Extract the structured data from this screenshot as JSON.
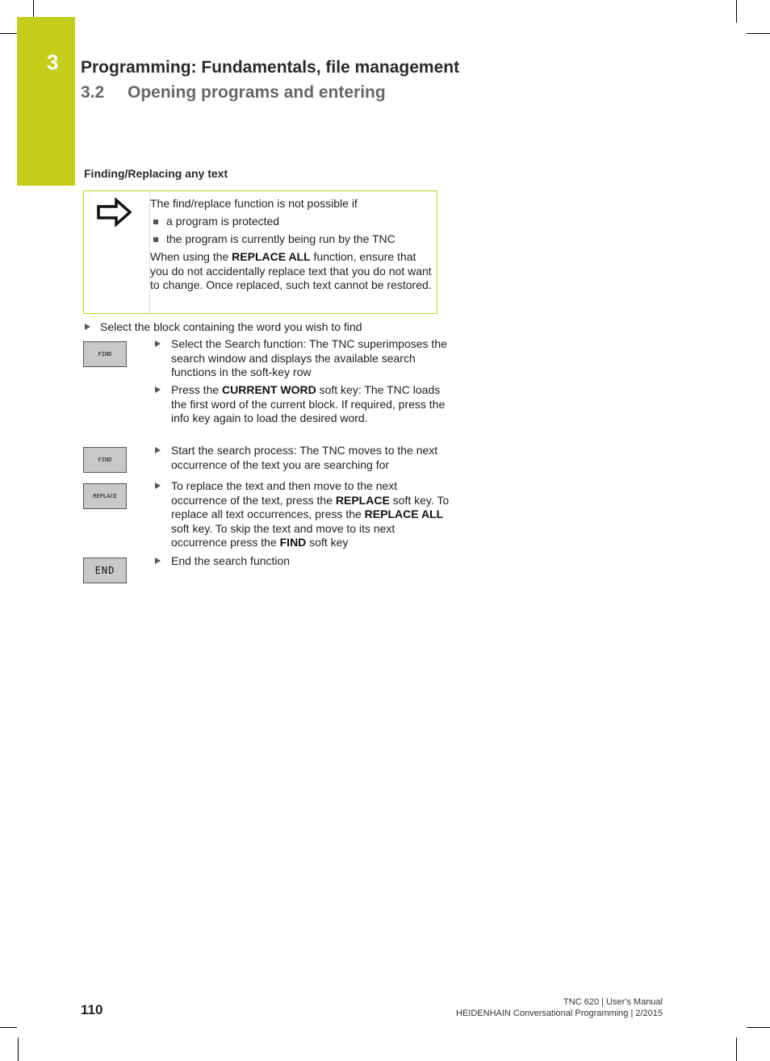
{
  "chapter": {
    "number": "3",
    "title": "Programming: Fundamentals, file management",
    "section_number": "3.2",
    "section_title": "Opening programs and entering",
    "accent_color": "#c4cd1a"
  },
  "subsection_title": "Finding/Replacing any text",
  "note": {
    "icon": "arrow-right-icon",
    "intro": "The find/replace function is not possible if",
    "bullets": [
      "a program is protected",
      "the program is currently being run by the TNC"
    ],
    "warning_pre": "When using the ",
    "warning_bold": "REPLACE ALL",
    "warning_post": " function, ensure that you do not accidentally replace text that you do not want to change. Once replaced, such text cannot be restored."
  },
  "intro_step": "Select the block containing the word you wish to find",
  "softkeys": {
    "find1": "FIND",
    "find2": "FIND",
    "replace": "REPLACE",
    "end": "END"
  },
  "steps": {
    "s1": "Select the Search function: The TNC superimposes the search window and displays the available search functions in the soft-key row",
    "s2_pre": "Press the ",
    "s2_bold": "CURRENT WORD",
    "s2_post": " soft key: The TNC loads the first word of the current block. If required, press the info key again to load the desired word.",
    "s3": "Start the search process: The TNC moves to the next occurrence of the text you are searching for",
    "s4_a": "To replace the text and then move to the next occurrence of the text, press the ",
    "s4_b": "REPLACE",
    "s4_c": " soft key. To replace all text occurrences, press the ",
    "s4_d": "REPLACE ALL",
    "s4_e": " soft key. To skip the text and move to its next occurrence press the ",
    "s4_f": "FIND",
    "s4_g": " soft key",
    "s5": "End the search function"
  },
  "footer": {
    "page_number": "110",
    "line1": "TNC 620 | User's Manual",
    "line2": "HEIDENHAIN Conversational Programming | 2/2015"
  }
}
